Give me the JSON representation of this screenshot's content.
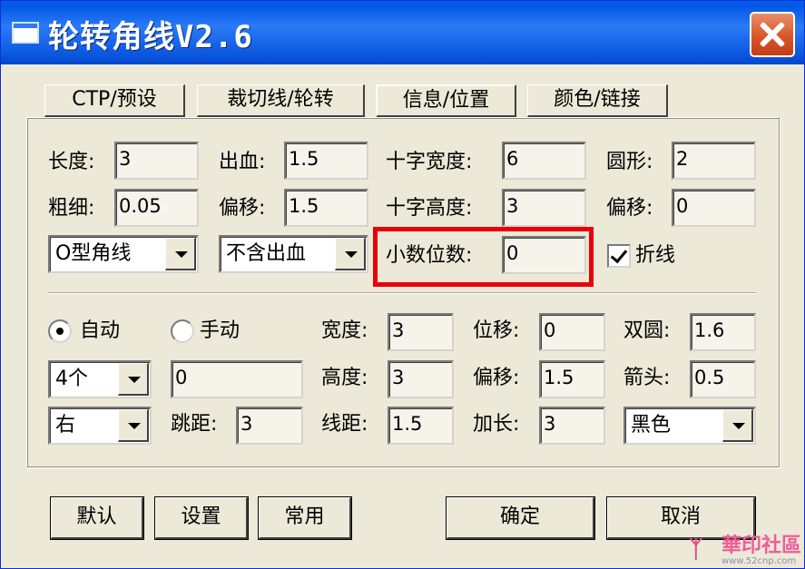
{
  "window": {
    "title": "轮转角线V2.6"
  },
  "tabs": [
    {
      "label": "CTP/预设"
    },
    {
      "label": "裁切线/轮转"
    },
    {
      "label": "信息/位置"
    },
    {
      "label": "颜色/链接"
    }
  ],
  "top": {
    "length_label": "长度:",
    "length_value": "3",
    "bleed_label": "出血:",
    "bleed_value": "1.5",
    "cross_width_label": "十字宽度:",
    "cross_width_value": "6",
    "circle_label": "圆形:",
    "circle_value": "2",
    "thickness_label": "粗细:",
    "thickness_value": "0.05",
    "offset_label": "偏移:",
    "offset_value": "1.5",
    "cross_height_label": "十字高度:",
    "cross_height_value": "3",
    "offset2_label": "偏移:",
    "offset2_value": "0",
    "corner_type_value": "O型角线",
    "bleed_mode_value": "不含出血",
    "decimal_label": "小数位数:",
    "decimal_value": "0",
    "polyline_label": "折线"
  },
  "bottom": {
    "auto_label": "自动",
    "manual_label": "手动",
    "count_value": "4个",
    "count_text_value": "0",
    "side_value": "右",
    "jump_label": "跳距:",
    "jump_value": "3",
    "width_label": "宽度:",
    "width_value": "3",
    "height_label": "高度:",
    "height_value": "3",
    "line_gap_label": "线距:",
    "line_gap_value": "1.5",
    "shift_label": "位移:",
    "shift_value": "0",
    "offset_label": "偏移:",
    "offset_value": "1.5",
    "extend_label": "加长:",
    "extend_value": "3",
    "double_circle_label": "双圆:",
    "double_circle_value": "1.6",
    "arrow_label": "箭头:",
    "arrow_value": "0.5",
    "color_value": "黑色"
  },
  "buttons": {
    "default_label": "默认",
    "settings_label": "设置",
    "common_label": "常用",
    "ok_label": "确定",
    "cancel_label": "取消"
  },
  "watermark": {
    "text": "華印社區",
    "url": "www.52cnp.com"
  },
  "colors": {
    "titlebar": "#0058e6",
    "highlight": "#e8000b",
    "face": "#ece9d8"
  }
}
